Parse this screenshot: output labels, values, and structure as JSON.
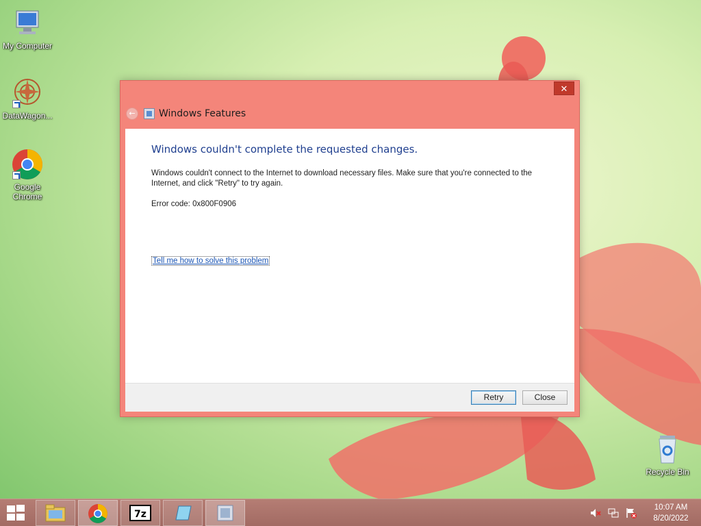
{
  "desktop": {
    "icons": [
      {
        "label": "My Computer"
      },
      {
        "label": "DataWagon..."
      },
      {
        "label": "Google Chrome"
      },
      {
        "label": "Recycle Bin"
      }
    ]
  },
  "dialog": {
    "close_glyph": "✕",
    "back_glyph": "←",
    "title": "Windows Features",
    "heading": "Windows couldn't complete the requested changes.",
    "message": "Windows couldn't connect to the Internet to download necessary files. Make sure that you're connected to the Internet, and click \"Retry\" to try again.",
    "error_code": "Error code: 0x800F0906",
    "help_link": "Tell me how to solve this problem",
    "retry_label": "Retry",
    "close_label": "Close"
  },
  "taskbar": {
    "apps": [
      {
        "name": "file-explorer-icon"
      },
      {
        "name": "chrome-icon"
      },
      {
        "name": "7zip-icon"
      },
      {
        "name": "notepad-icon"
      },
      {
        "name": "windows-features-icon"
      }
    ],
    "seven_zip_text": "7z",
    "clock_time": "10:07 AM",
    "clock_date": "8/20/2022"
  },
  "colors": {
    "window_frame": "#f4857a",
    "heading_blue": "#1f3f8f",
    "link_blue": "#1a55b5"
  }
}
